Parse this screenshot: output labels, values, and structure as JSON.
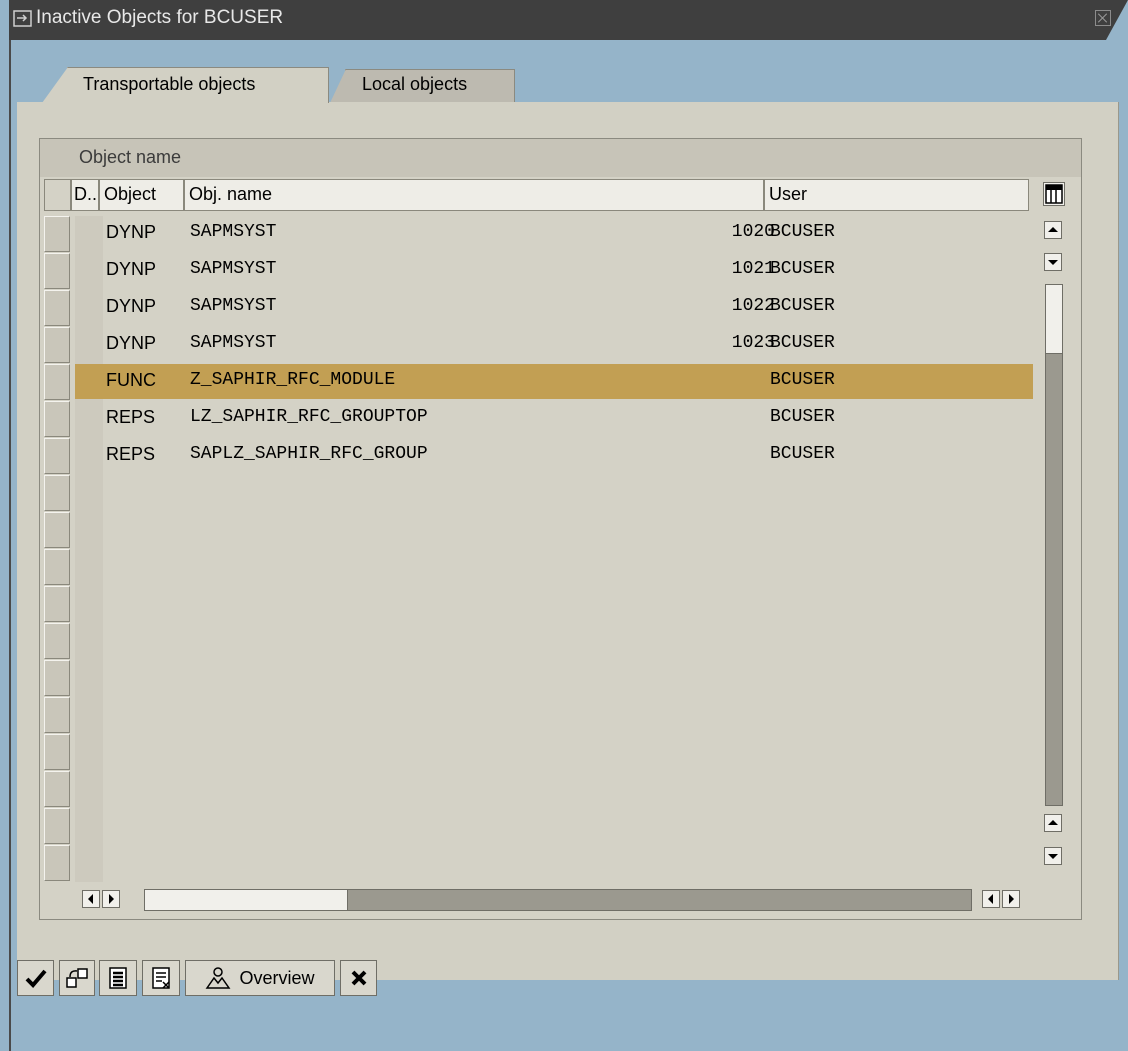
{
  "window": {
    "title": "Inactive Objects for BCUSER"
  },
  "tabs": [
    {
      "label": "Transportable objects",
      "active": true
    },
    {
      "label": "Local objects",
      "active": false
    }
  ],
  "table": {
    "group_header": "Object name",
    "columns": {
      "d": "D..",
      "object": "Object",
      "obj_name": "Obj. name",
      "user": "User"
    },
    "rows": [
      {
        "object": "DYNP",
        "obj_name": "SAPMSYST",
        "num": "1020",
        "user": "BCUSER",
        "selected": false
      },
      {
        "object": "DYNP",
        "obj_name": "SAPMSYST",
        "num": "1021",
        "user": "BCUSER",
        "selected": false
      },
      {
        "object": "DYNP",
        "obj_name": "SAPMSYST",
        "num": "1022",
        "user": "BCUSER",
        "selected": false
      },
      {
        "object": "DYNP",
        "obj_name": "SAPMSYST",
        "num": "1023",
        "user": "BCUSER",
        "selected": false
      },
      {
        "object": "FUNC",
        "obj_name": "Z_SAPHIR_RFC_MODULE",
        "num": "",
        "user": "BCUSER",
        "selected": true
      },
      {
        "object": "REPS",
        "obj_name": "LZ_SAPHIR_RFC_GROUPTOP",
        "num": "",
        "user": "BCUSER",
        "selected": false
      },
      {
        "object": "REPS",
        "obj_name": "SAPLZ_SAPHIR_RFC_GROUP",
        "num": "",
        "user": "BCUSER",
        "selected": false
      }
    ]
  },
  "toolbar": {
    "overview_label": "Overview",
    "buttons": [
      "check-icon",
      "activate-icon",
      "select-all-icon",
      "deselect-all-icon",
      "overview-icon",
      "cancel-icon"
    ]
  },
  "colors": {
    "selected_row": "#c29f53",
    "background": "#95b4c9",
    "panel": "#d2d0c4"
  }
}
